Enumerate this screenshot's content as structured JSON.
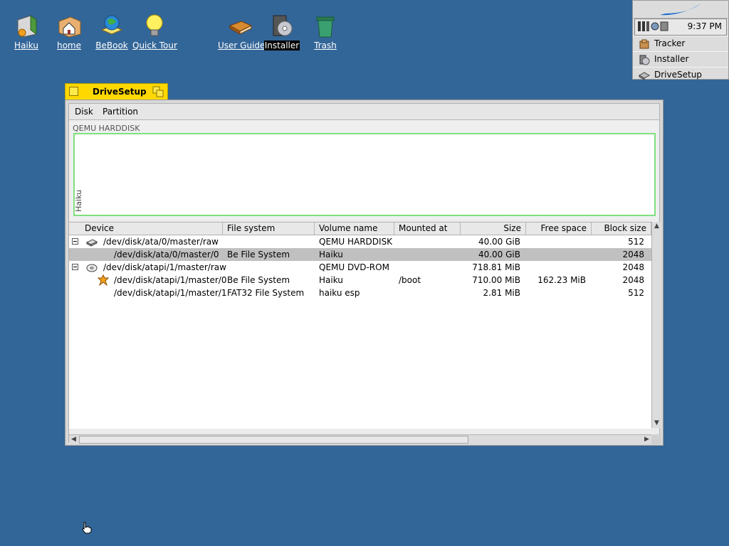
{
  "desktop": {
    "icons": [
      {
        "label": "Haiku"
      },
      {
        "label": "home"
      },
      {
        "label": "BeBook"
      },
      {
        "label": "Quick Tour"
      },
      {
        "label": "User Guide"
      },
      {
        "label": "Installer"
      },
      {
        "label": "Trash"
      }
    ]
  },
  "deskbar": {
    "clock": "9:37 PM",
    "apps": [
      {
        "label": "Tracker",
        "icon": "tracker-icon"
      },
      {
        "label": "Installer",
        "icon": "installer-icon"
      },
      {
        "label": "DriveSetup",
        "icon": "drivesetup-icon"
      }
    ]
  },
  "window": {
    "title": "DriveSetup",
    "menus": [
      "Disk",
      "Partition"
    ],
    "disk_map": {
      "disk_label": "QEMU HARDDISK",
      "partition_label": "Haiku",
      "partition_color": "#7ee07e"
    },
    "columns": [
      "Device",
      "File system",
      "Volume name",
      "Mounted at",
      "Size",
      "Free space",
      "Block size"
    ],
    "rows": [
      {
        "device": "/dev/disk/ata/0/master/raw",
        "fs": "",
        "volume": "QEMU HARDDISK",
        "mounted": "",
        "size": "40.00 GiB",
        "free": "",
        "block": "512",
        "icon": "harddisk-icon",
        "level": 0,
        "expander": true
      },
      {
        "device": "/dev/disk/ata/0/master/0",
        "fs": "Be File System",
        "volume": "Haiku",
        "mounted": "",
        "size": "40.00 GiB",
        "free": "",
        "block": "2048",
        "icon": "",
        "level": 1,
        "expander": false,
        "selected": true
      },
      {
        "device": "/dev/disk/atapi/1/master/raw",
        "fs": "",
        "volume": "QEMU DVD-ROM",
        "mounted": "",
        "size": "718.81 MiB",
        "free": "",
        "block": "2048",
        "icon": "cdrom-icon",
        "level": 0,
        "expander": true
      },
      {
        "device": "/dev/disk/atapi/1/master/0",
        "fs": "Be File System",
        "volume": "Haiku",
        "mounted": "/boot",
        "size": "710.00 MiB",
        "free": "162.23 MiB",
        "block": "2048",
        "icon": "haiku-leaf-icon",
        "level": 1,
        "expander": false
      },
      {
        "device": "/dev/disk/atapi/1/master/1",
        "fs": "FAT32 File System",
        "volume": "haiku esp",
        "mounted": "",
        "size": "2.81 MiB",
        "free": "",
        "block": "512",
        "icon": "",
        "level": 1,
        "expander": false
      }
    ]
  },
  "colors": {
    "desktop": "#336698",
    "window_tab": "#ffd800",
    "selection": "#c0c0c0"
  }
}
